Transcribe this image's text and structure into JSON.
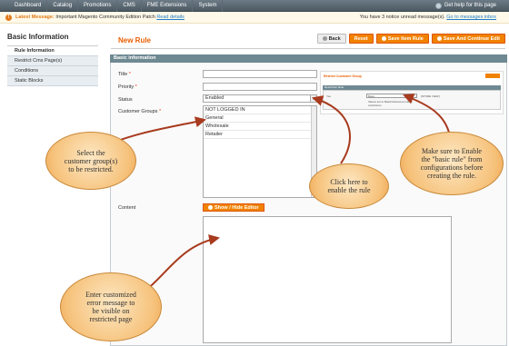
{
  "topnav": {
    "items": [
      "Dashboard",
      "Catalog",
      "Promotions",
      "CMS",
      "FME Extensions",
      "System"
    ],
    "help": "Get help for this page"
  },
  "notice": {
    "label": "Latest Message:",
    "message": "Important Magento Community Edition Patch",
    "read_details": "Read details",
    "count_text": "You have 3 notice unread message(s).",
    "go_link": "Go to messages inbox"
  },
  "sidebar": {
    "title": "Basic Information",
    "tabs": [
      "Rule Information",
      "Restrict Cms Page(s)",
      "Conditions",
      "Static Blocks"
    ]
  },
  "header": {
    "title": "New Rule",
    "back": "Back",
    "reset": "Reset",
    "save_item": "Save Item Rule",
    "save_continue": "Save And Continue Edit"
  },
  "form": {
    "section_title": "Basic information",
    "title_label": "Title",
    "priority_label": "Priority",
    "status_label": "Status",
    "status_value": "Enabled",
    "groups_label": "Customer Groups",
    "groups": [
      "NOT LOGGED IN",
      "General",
      "Wholesale",
      "Retailer"
    ],
    "content_label": "Content",
    "editor_button": "Show / Hide Editor",
    "required_mark": "*"
  },
  "inset": {
    "title": "Restrict Customer Group",
    "section": "Restriction Rule",
    "field": "Yes",
    "value": "Basic",
    "note": "Values set to Basic/Advanced rule to",
    "note2": "restrictions",
    "scope": "[STORE VIEW]"
  },
  "callouts": {
    "groups": [
      "Select the",
      "customer group(s)",
      "to be restricted."
    ],
    "status": [
      "Click here to",
      "enable the rule"
    ],
    "basic_rule": [
      "Make sure to Enable",
      "the \"basic rule\" from",
      "configurations before",
      "creating the rule."
    ],
    "content": [
      "Enter customized",
      "error message to",
      "be visible on",
      "restricted page"
    ]
  }
}
